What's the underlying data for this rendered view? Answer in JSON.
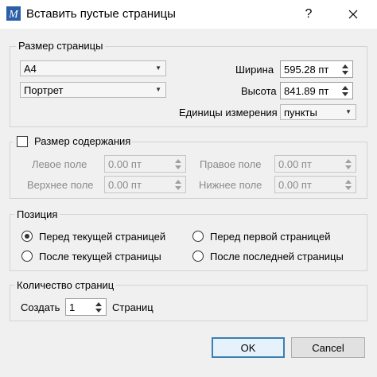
{
  "window": {
    "title": "Вставить пустые страницы",
    "help_label": "?",
    "app_icon_letter": "M"
  },
  "page_size": {
    "group_label": "Размер страницы",
    "format_value": "A4",
    "orientation_value": "Портрет",
    "width_label": "Ширина",
    "width_value": "595.28 пт",
    "height_label": "Высота",
    "height_value": "841.89 пт",
    "units_label": "Единицы измерения",
    "units_value": "пункты"
  },
  "content_size": {
    "checkbox_label": "Размер содержания",
    "checked": false,
    "left_label": "Левое поле",
    "left_value": "0.00 пт",
    "right_label": "Правое поле",
    "right_value": "0.00 пт",
    "top_label": "Верхнее поле",
    "top_value": "0.00 пт",
    "bottom_label": "Нижнее поле",
    "bottom_value": "0.00 пт"
  },
  "position": {
    "group_label": "Позиция",
    "options": [
      {
        "label": "Перед текущей страницей",
        "checked": true
      },
      {
        "label": "Перед первой страницей",
        "checked": false
      },
      {
        "label": "После текущей страницы",
        "checked": false
      },
      {
        "label": "После последней страницы",
        "checked": false
      }
    ]
  },
  "page_count": {
    "group_label": "Количество страниц",
    "create_label": "Создать",
    "count_value": "1",
    "pages_label": "Страниц"
  },
  "buttons": {
    "ok_label": "OK",
    "cancel_label": "Cancel"
  },
  "colors": {
    "default_button_border": "#3c7fb1",
    "app_icon_bg": "#2b5fa8"
  }
}
